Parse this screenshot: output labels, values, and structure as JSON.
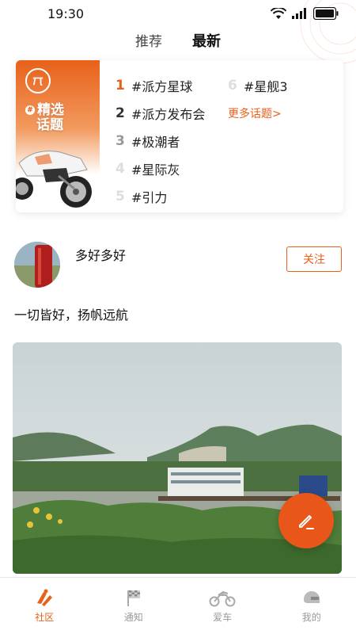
{
  "status_bar": {
    "time": "19:30"
  },
  "tabs": [
    {
      "label": "推荐",
      "active": false
    },
    {
      "label": "最新",
      "active": true
    }
  ],
  "topics": {
    "banner_title_line1": "精选",
    "banner_title_line2": "话题",
    "banner_hash": "#",
    "items": [
      {
        "rank": "1",
        "label": "#派方星球",
        "rank_color": "#e8611a"
      },
      {
        "rank": "2",
        "label": "#派方发布会",
        "rank_color": "#333333"
      },
      {
        "rank": "3",
        "label": "#极潮者",
        "rank_color": "#999999"
      },
      {
        "rank": "4",
        "label": "#星际灰",
        "rank_color": "#dddddd"
      },
      {
        "rank": "5",
        "label": "#引力",
        "rank_color": "#dddddd"
      },
      {
        "rank": "6",
        "label": "#星舰3",
        "rank_color": "#dddddd"
      }
    ],
    "more_label": "更多话题>"
  },
  "post": {
    "username": "多好多好",
    "follow_label": "关注",
    "text": "一切皆好，扬帆远航"
  },
  "bottom_nav": [
    {
      "label": "社区",
      "icon": "community-icon",
      "active": true
    },
    {
      "label": "通知",
      "icon": "flag-icon",
      "active": false
    },
    {
      "label": "爱车",
      "icon": "motorcycle-icon",
      "active": false
    },
    {
      "label": "我的",
      "icon": "helmet-icon",
      "active": false
    }
  ],
  "colors": {
    "accent": "#e8611a"
  }
}
